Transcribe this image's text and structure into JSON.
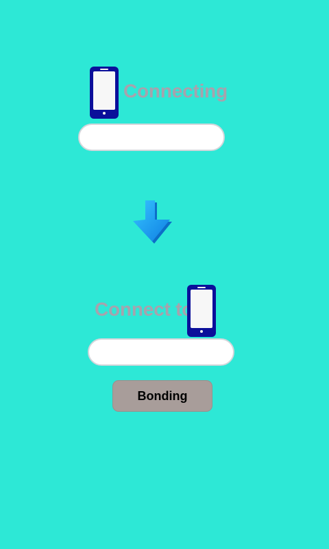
{
  "source": {
    "label": "Connecting",
    "icon": "smartphone-icon",
    "input_value": ""
  },
  "direction": {
    "icon": "down-arrow-icon"
  },
  "target": {
    "label": "Connect to",
    "icon": "smartphone-icon",
    "input_value": ""
  },
  "actions": {
    "bonding_label": "Bonding"
  },
  "colors": {
    "background": "#2de8d6",
    "label_text": "#a6a3ad",
    "phone_body": "#0b0f9a",
    "button_bg": "#a89d9a",
    "arrow": "#1da0f2"
  }
}
